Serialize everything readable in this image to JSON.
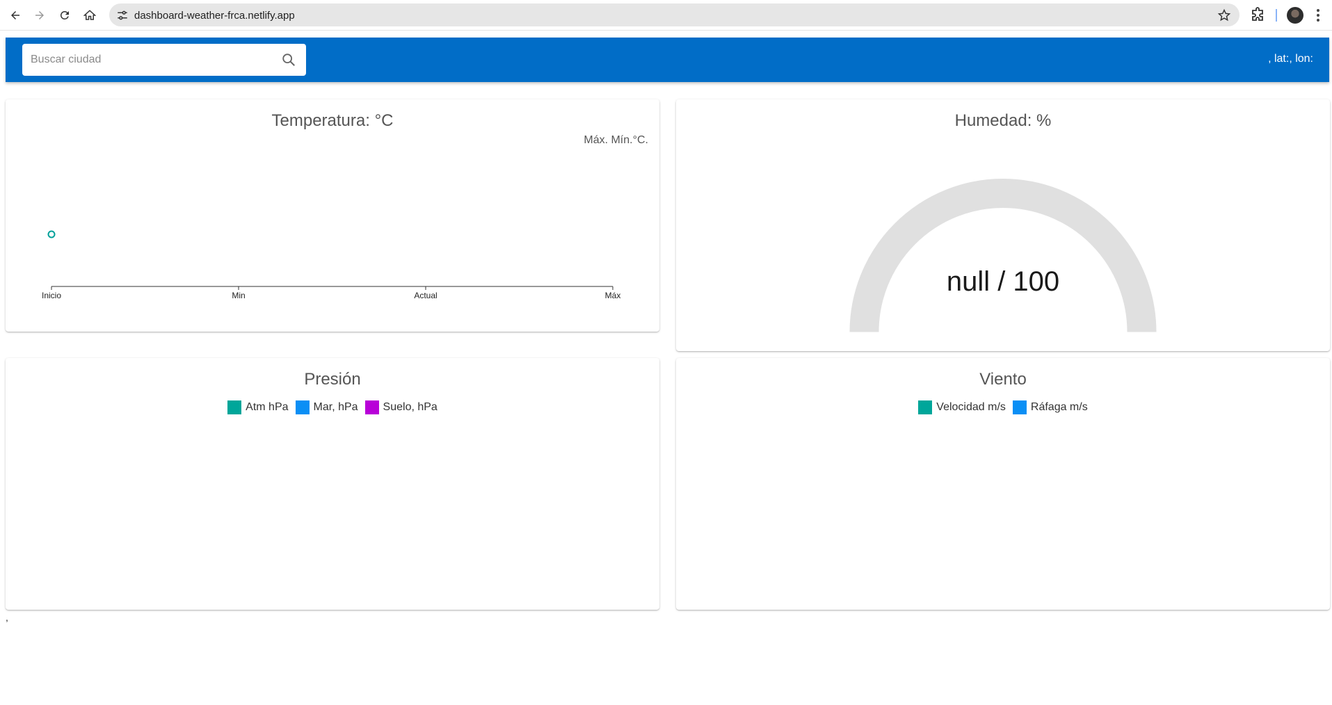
{
  "browser": {
    "url": "dashboard-weather-frca.netlify.app"
  },
  "header": {
    "search_placeholder": "Buscar ciudad",
    "coords_text": ", lat:, lon:"
  },
  "temperature": {
    "title": "Temperatura: °C",
    "maxmin_label": "Máx. Mín.°C.",
    "x_ticks": [
      "Inicio",
      "Min",
      "Actual",
      "Máx"
    ],
    "point_color": "#00a09a"
  },
  "humidity": {
    "title": "Humedad: %",
    "gauge_text": "null / 100",
    "value": null,
    "max": 100
  },
  "pressure": {
    "title": "Presión",
    "legend": [
      {
        "label": "Atm hPa",
        "color": "#00a69a"
      },
      {
        "label": "Mar, hPa",
        "color": "#0a8ff5"
      },
      {
        "label": "Suelo, hPa",
        "color": "#b800d8"
      }
    ]
  },
  "wind": {
    "title": "Viento",
    "legend": [
      {
        "label": "Velocidad m/s",
        "color": "#00a69a"
      },
      {
        "label": "Ráfaga m/s",
        "color": "#0a8ff5"
      }
    ]
  },
  "footer": {
    "text": ","
  },
  "chart_data": [
    {
      "type": "scatter",
      "title": "Temperatura: °C",
      "categories": [
        "Inicio",
        "Min",
        "Actual",
        "Máx"
      ],
      "series": [
        {
          "values": [
            null,
            null,
            null,
            null
          ]
        }
      ]
    },
    {
      "type": "line",
      "title": "Presión",
      "series": [
        {
          "name": "Atm hPa",
          "values": []
        },
        {
          "name": "Mar, hPa",
          "values": []
        },
        {
          "name": "Suelo, hPa",
          "values": []
        }
      ]
    },
    {
      "type": "line",
      "title": "Viento",
      "series": [
        {
          "name": "Velocidad m/s",
          "values": []
        },
        {
          "name": "Ráfaga m/s",
          "values": []
        }
      ]
    }
  ]
}
